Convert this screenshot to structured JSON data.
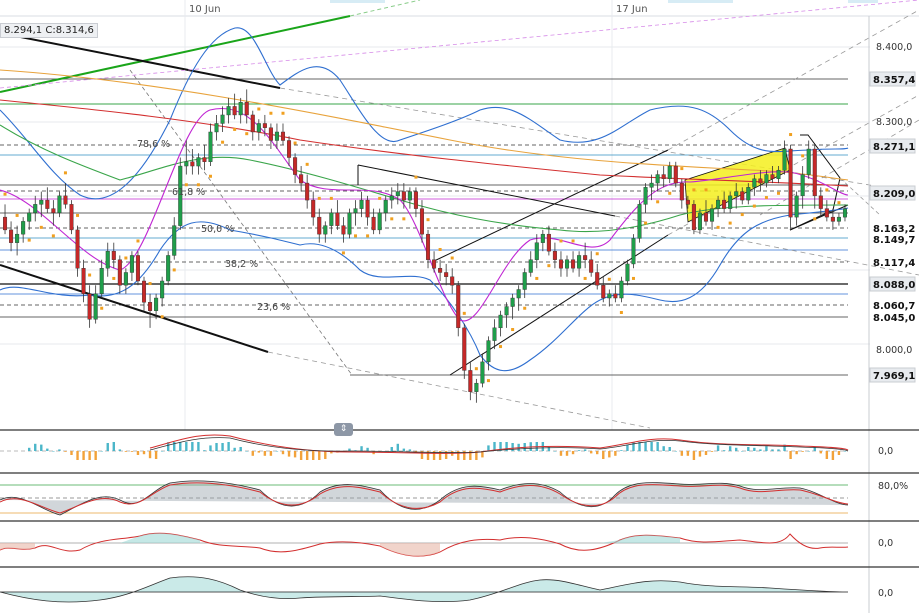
{
  "ohlc_readout": "8.294,1  C:8.314,6",
  "chart_data": {
    "type": "candlestick",
    "date_labels": [
      "10 Jun",
      "17 Jun"
    ],
    "price_axis": {
      "ylim": [
        7.94,
        8.445
      ],
      "ticks": [
        {
          "value": 8.4,
          "label": "8.400,0"
        },
        {
          "value": 8.3,
          "label": "8.300,0"
        },
        {
          "value": 8.0,
          "label": "8.000,0"
        }
      ]
    },
    "price_markers": [
      {
        "value": 8.3574,
        "label": "8.357,4"
      },
      {
        "value": 8.2711,
        "label": "8.271,1"
      },
      {
        "value": 8.209,
        "label": "8.209,0"
      },
      {
        "value": 8.1632,
        "label": "8.163,2"
      },
      {
        "value": 8.1497,
        "label": "8.149,7"
      },
      {
        "value": 8.1174,
        "label": "8.117,4"
      },
      {
        "value": 8.088,
        "label": "8.088,0"
      },
      {
        "value": 8.0607,
        "label": "8.060,7"
      },
      {
        "value": 8.045,
        "label": "8.045,0"
      },
      {
        "value": 7.9691,
        "label": "7.969,1"
      }
    ],
    "fibonacci_levels": [
      {
        "label": "78,6 %",
        "value": 8.271
      },
      {
        "label": "61,8 %",
        "value": 8.211
      },
      {
        "label": "50,0 %",
        "value": 8.163
      },
      {
        "label": "38,2 %",
        "value": 8.117
      },
      {
        "label": "23,6 %",
        "value": 8.06
      }
    ],
    "candles": [
      [
        8.19,
        8.205,
        8.17,
        8.175
      ],
      [
        8.175,
        8.185,
        8.15,
        8.16
      ],
      [
        8.16,
        8.18,
        8.145,
        8.17
      ],
      [
        8.17,
        8.19,
        8.16,
        8.185
      ],
      [
        8.185,
        8.2,
        8.175,
        8.195
      ],
      [
        8.195,
        8.215,
        8.185,
        8.205
      ],
      [
        8.205,
        8.22,
        8.19,
        8.21
      ],
      [
        8.21,
        8.225,
        8.195,
        8.2
      ],
      [
        8.2,
        8.21,
        8.18,
        8.195
      ],
      [
        8.195,
        8.22,
        8.19,
        8.215
      ],
      [
        8.215,
        8.23,
        8.2,
        8.205
      ],
      [
        8.205,
        8.21,
        8.17,
        8.175
      ],
      [
        8.175,
        8.18,
        8.12,
        8.13
      ],
      [
        8.13,
        8.14,
        8.09,
        8.1
      ],
      [
        8.1,
        8.11,
        8.06,
        8.07
      ],
      [
        8.07,
        8.11,
        8.065,
        8.1
      ],
      [
        8.1,
        8.14,
        8.095,
        8.13
      ],
      [
        8.13,
        8.16,
        8.12,
        8.15
      ],
      [
        8.15,
        8.16,
        8.13,
        8.14
      ],
      [
        8.14,
        8.145,
        8.1,
        8.11
      ],
      [
        8.11,
        8.13,
        8.1,
        8.125
      ],
      [
        8.125,
        8.15,
        8.115,
        8.145
      ],
      [
        8.145,
        8.15,
        8.11,
        8.115
      ],
      [
        8.115,
        8.12,
        8.08,
        8.09
      ],
      [
        8.09,
        8.1,
        8.06,
        8.08
      ],
      [
        8.08,
        8.1,
        8.07,
        8.095
      ],
      [
        8.095,
        8.12,
        8.085,
        8.115
      ],
      [
        8.115,
        8.15,
        8.11,
        8.145
      ],
      [
        8.145,
        8.19,
        8.14,
        8.18
      ],
      [
        8.18,
        8.26,
        8.175,
        8.25
      ],
      [
        8.25,
        8.28,
        8.24,
        8.255
      ],
      [
        8.255,
        8.27,
        8.24,
        8.25
      ],
      [
        8.25,
        8.265,
        8.24,
        8.26
      ],
      [
        8.26,
        8.275,
        8.245,
        8.255
      ],
      [
        8.255,
        8.3,
        8.25,
        8.29
      ],
      [
        8.29,
        8.31,
        8.28,
        8.3
      ],
      [
        8.3,
        8.32,
        8.29,
        8.31
      ],
      [
        8.31,
        8.33,
        8.3,
        8.32
      ],
      [
        8.32,
        8.335,
        8.305,
        8.31
      ],
      [
        8.31,
        8.33,
        8.3,
        8.325
      ],
      [
        8.325,
        8.34,
        8.3,
        8.31
      ],
      [
        8.31,
        8.315,
        8.28,
        8.29
      ],
      [
        8.29,
        8.305,
        8.28,
        8.3
      ],
      [
        8.3,
        8.31,
        8.285,
        8.295
      ],
      [
        8.295,
        8.3,
        8.27,
        8.28
      ],
      [
        8.28,
        8.3,
        8.27,
        8.29
      ],
      [
        8.29,
        8.3,
        8.275,
        8.28
      ],
      [
        8.28,
        8.285,
        8.25,
        8.26
      ],
      [
        8.26,
        8.265,
        8.23,
        8.24
      ],
      [
        8.24,
        8.25,
        8.22,
        8.23
      ],
      [
        8.23,
        8.24,
        8.2,
        8.21
      ],
      [
        8.21,
        8.22,
        8.18,
        8.19
      ],
      [
        8.19,
        8.2,
        8.16,
        8.17
      ],
      [
        8.17,
        8.185,
        8.16,
        8.18
      ],
      [
        8.18,
        8.2,
        8.17,
        8.195
      ],
      [
        8.195,
        8.21,
        8.175,
        8.18
      ],
      [
        8.18,
        8.19,
        8.16,
        8.17
      ],
      [
        8.17,
        8.2,
        8.165,
        8.195
      ],
      [
        8.195,
        8.21,
        8.18,
        8.2
      ],
      [
        8.2,
        8.22,
        8.19,
        8.21
      ],
      [
        8.21,
        8.215,
        8.18,
        8.19
      ],
      [
        8.19,
        8.2,
        8.17,
        8.175
      ],
      [
        8.175,
        8.2,
        8.17,
        8.195
      ],
      [
        8.195,
        8.215,
        8.185,
        8.21
      ],
      [
        8.21,
        8.225,
        8.2,
        8.215
      ],
      [
        8.215,
        8.23,
        8.205,
        8.22
      ],
      [
        8.22,
        8.23,
        8.2,
        8.21
      ],
      [
        8.21,
        8.225,
        8.2,
        8.22
      ],
      [
        8.22,
        8.225,
        8.19,
        8.2
      ],
      [
        8.2,
        8.21,
        8.16,
        8.17
      ],
      [
        8.17,
        8.175,
        8.13,
        8.14
      ],
      [
        8.14,
        8.15,
        8.125,
        8.13
      ],
      [
        8.13,
        8.14,
        8.115,
        8.125
      ],
      [
        8.125,
        8.135,
        8.11,
        8.12
      ],
      [
        8.12,
        8.13,
        8.1,
        8.11
      ],
      [
        8.11,
        8.115,
        8.05,
        8.06
      ],
      [
        8.06,
        8.065,
        8.0,
        8.01
      ],
      [
        8.01,
        8.02,
        7.975,
        7.985
      ],
      [
        7.985,
        8.0,
        7.972,
        7.995
      ],
      [
        7.995,
        8.03,
        7.99,
        8.02
      ],
      [
        8.02,
        8.05,
        8.01,
        8.045
      ],
      [
        8.045,
        8.07,
        8.035,
        8.06
      ],
      [
        8.06,
        8.08,
        8.05,
        8.075
      ],
      [
        8.075,
        8.09,
        8.06,
        8.085
      ],
      [
        8.085,
        8.1,
        8.07,
        8.095
      ],
      [
        8.095,
        8.11,
        8.08,
        8.105
      ],
      [
        8.105,
        8.13,
        8.095,
        8.125
      ],
      [
        8.125,
        8.15,
        8.12,
        8.14
      ],
      [
        8.14,
        8.17,
        8.13,
        8.16
      ],
      [
        8.16,
        8.175,
        8.15,
        8.17
      ],
      [
        8.17,
        8.18,
        8.145,
        8.15
      ],
      [
        8.15,
        8.16,
        8.13,
        8.14
      ],
      [
        8.14,
        8.15,
        8.12,
        8.13
      ],
      [
        8.13,
        8.145,
        8.12,
        8.14
      ],
      [
        8.14,
        8.15,
        8.125,
        8.13
      ],
      [
        8.13,
        8.15,
        8.12,
        8.145
      ],
      [
        8.145,
        8.16,
        8.13,
        8.14
      ],
      [
        8.14,
        8.15,
        8.12,
        8.125
      ],
      [
        8.125,
        8.135,
        8.105,
        8.11
      ],
      [
        8.11,
        8.12,
        8.09,
        8.095
      ],
      [
        8.095,
        8.105,
        8.085,
        8.1
      ],
      [
        8.1,
        8.11,
        8.09,
        8.095
      ],
      [
        8.095,
        8.12,
        8.09,
        8.115
      ],
      [
        8.115,
        8.14,
        8.11,
        8.135
      ],
      [
        8.135,
        8.17,
        8.13,
        8.165
      ],
      [
        8.165,
        8.21,
        8.16,
        8.205
      ],
      [
        8.205,
        8.23,
        8.195,
        8.225
      ],
      [
        8.225,
        8.24,
        8.21,
        8.23
      ],
      [
        8.23,
        8.245,
        8.22,
        8.24
      ],
      [
        8.24,
        8.25,
        8.225,
        8.235
      ],
      [
        8.235,
        8.255,
        8.23,
        8.25
      ],
      [
        8.25,
        8.255,
        8.225,
        8.23
      ],
      [
        8.23,
        8.235,
        8.2,
        8.21
      ],
      [
        8.21,
        8.215,
        8.2,
        8.205
      ],
      [
        8.205,
        8.21,
        8.17,
        8.175
      ],
      [
        8.175,
        8.2,
        8.17,
        8.195
      ],
      [
        8.195,
        8.21,
        8.18,
        8.185
      ],
      [
        8.185,
        8.205,
        8.175,
        8.2
      ],
      [
        8.2,
        8.215,
        8.19,
        8.21
      ],
      [
        8.21,
        8.22,
        8.195,
        8.2
      ],
      [
        8.2,
        8.22,
        8.195,
        8.215
      ],
      [
        8.215,
        8.23,
        8.2,
        8.22
      ],
      [
        8.22,
        8.225,
        8.205,
        8.21
      ],
      [
        8.21,
        8.23,
        8.205,
        8.225
      ],
      [
        8.225,
        8.24,
        8.215,
        8.235
      ],
      [
        8.235,
        8.245,
        8.22,
        8.23
      ],
      [
        8.23,
        8.245,
        8.225,
        8.24
      ],
      [
        8.24,
        8.25,
        8.23,
        8.235
      ],
      [
        8.235,
        8.25,
        8.23,
        8.245
      ],
      [
        8.245,
        8.28,
        8.24,
        8.27
      ],
      [
        8.27,
        8.275,
        8.175,
        8.19
      ],
      [
        8.19,
        8.22,
        8.18,
        8.215
      ],
      [
        8.215,
        8.25,
        8.2,
        8.24
      ],
      [
        8.24,
        8.28,
        8.235,
        8.27
      ],
      [
        8.27,
        8.275,
        8.2,
        8.215
      ],
      [
        8.215,
        8.225,
        8.19,
        8.2
      ],
      [
        8.2,
        8.21,
        8.185,
        8.19
      ],
      [
        8.19,
        8.2,
        8.175,
        8.185
      ],
      [
        8.185,
        8.195,
        8.18,
        8.19
      ],
      [
        8.19,
        8.205,
        8.185,
        8.2
      ]
    ]
  },
  "indicator_panels": [
    {
      "name": "macd",
      "label": "0,0"
    },
    {
      "name": "stochastic",
      "label": "80,0%"
    },
    {
      "name": "momentum",
      "label": "0,0"
    },
    {
      "name": "oscillator",
      "label": "0,0"
    }
  ],
  "colors": {
    "bull": "#1f9e4a",
    "bear": "#c62828",
    "bollinger": "#2f6fd0",
    "sma_red": "#d32f2f",
    "sma_orange": "#e8a33c",
    "sma_green": "#3aa54a",
    "sma_magenta": "#c026d3",
    "psar": "#f0a020",
    "channel_fill": "#f5ef1d",
    "hist_up": "#4bb6c9",
    "hist_down": "#f2a23a"
  }
}
